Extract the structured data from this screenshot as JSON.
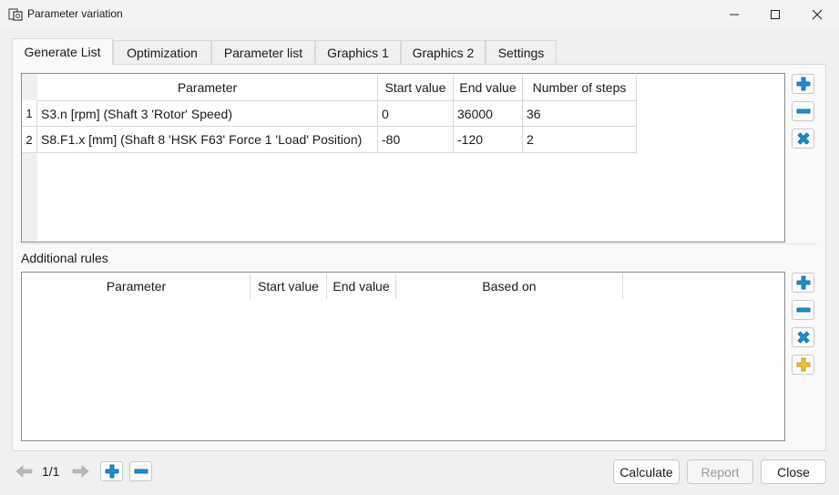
{
  "window": {
    "title": "Parameter variation",
    "controls": [
      "minimize",
      "maximize",
      "close"
    ]
  },
  "tabs": [
    {
      "label": "Generate List",
      "active": true
    },
    {
      "label": "Optimization",
      "active": false
    },
    {
      "label": "Parameter list",
      "active": false
    },
    {
      "label": "Graphics 1",
      "active": false
    },
    {
      "label": "Graphics 2",
      "active": false
    },
    {
      "label": "Settings",
      "active": false
    }
  ],
  "parameter_table": {
    "columns": [
      "Parameter",
      "Start value",
      "End value",
      "Number of steps"
    ],
    "rows": [
      {
        "num": "1",
        "parameter": "S3.n [rpm]  (Shaft 3 'Rotor' Speed)",
        "start": "0",
        "end": "36000",
        "steps": "36"
      },
      {
        "num": "2",
        "parameter": "S8.F1.x [mm]  (Shaft 8 'HSK F63' Force 1 'Load' Position)",
        "start": "-80",
        "end": "-120",
        "steps": "2"
      }
    ]
  },
  "additional_rules": {
    "label": "Additional rules",
    "columns": [
      "Parameter",
      "Start value",
      "End value",
      "Based on"
    ]
  },
  "side_buttons_top": [
    "add-icon",
    "remove-icon",
    "delete-all-icon"
  ],
  "side_buttons_bottom": [
    "add-icon",
    "remove-icon",
    "delete-all-icon",
    "add-yellow-icon"
  ],
  "bottom": {
    "page_indicator": "1/1",
    "calculate_label": "Calculate",
    "report_label": "Report",
    "report_enabled": false,
    "close_label": "Close"
  },
  "colors": {
    "accent_blue": "#1a8fd6",
    "icon_yellow": "#f2c230",
    "disabled_text": "#9a9a9a"
  }
}
